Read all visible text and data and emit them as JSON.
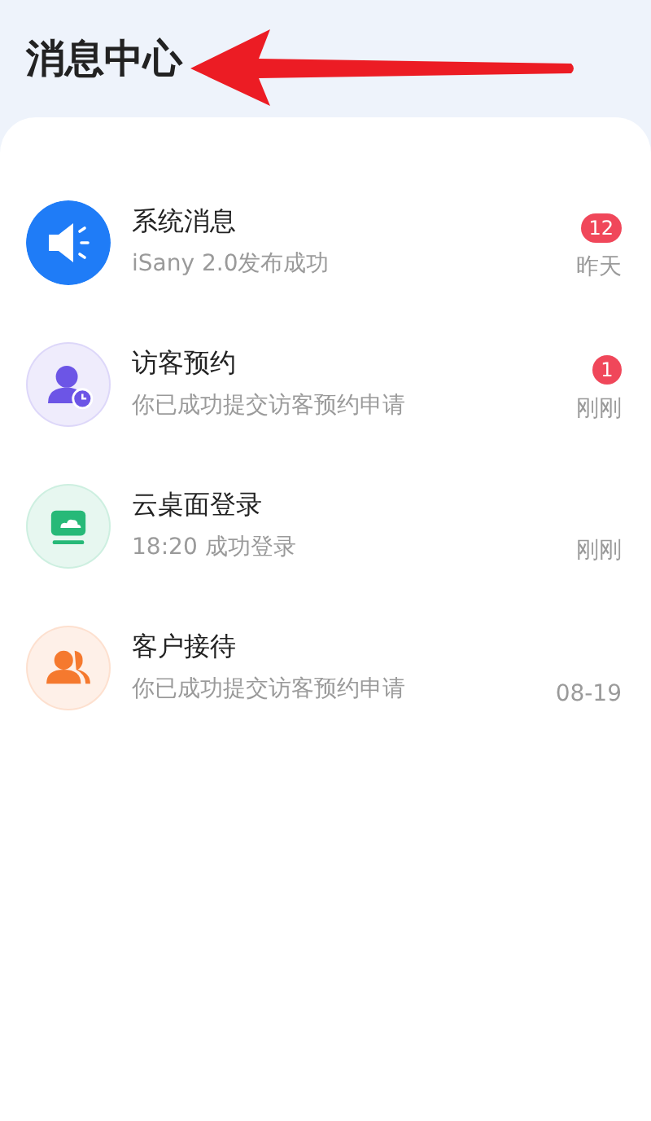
{
  "header": {
    "title": "消息中心"
  },
  "messages": [
    {
      "kind": "speaker",
      "color": "#1f7cf7",
      "title": "系统消息",
      "subtitle": "iSany 2.0发布成功",
      "badge": "12",
      "time": "昨天"
    },
    {
      "kind": "visitor",
      "color": "#6c55e6",
      "title": "访客预约",
      "subtitle": "你已成功提交访客预约申请",
      "badge": "1",
      "time": "刚刚"
    },
    {
      "kind": "desktop",
      "color": "#27b978",
      "title": "云桌面登录",
      "subtitle": "18:20 成功登录",
      "time": "刚刚"
    },
    {
      "kind": "people",
      "color": "#f5792e",
      "title": "客户接待",
      "subtitle": "你已成功提交访客预约申请",
      "time": "08-19"
    }
  ]
}
